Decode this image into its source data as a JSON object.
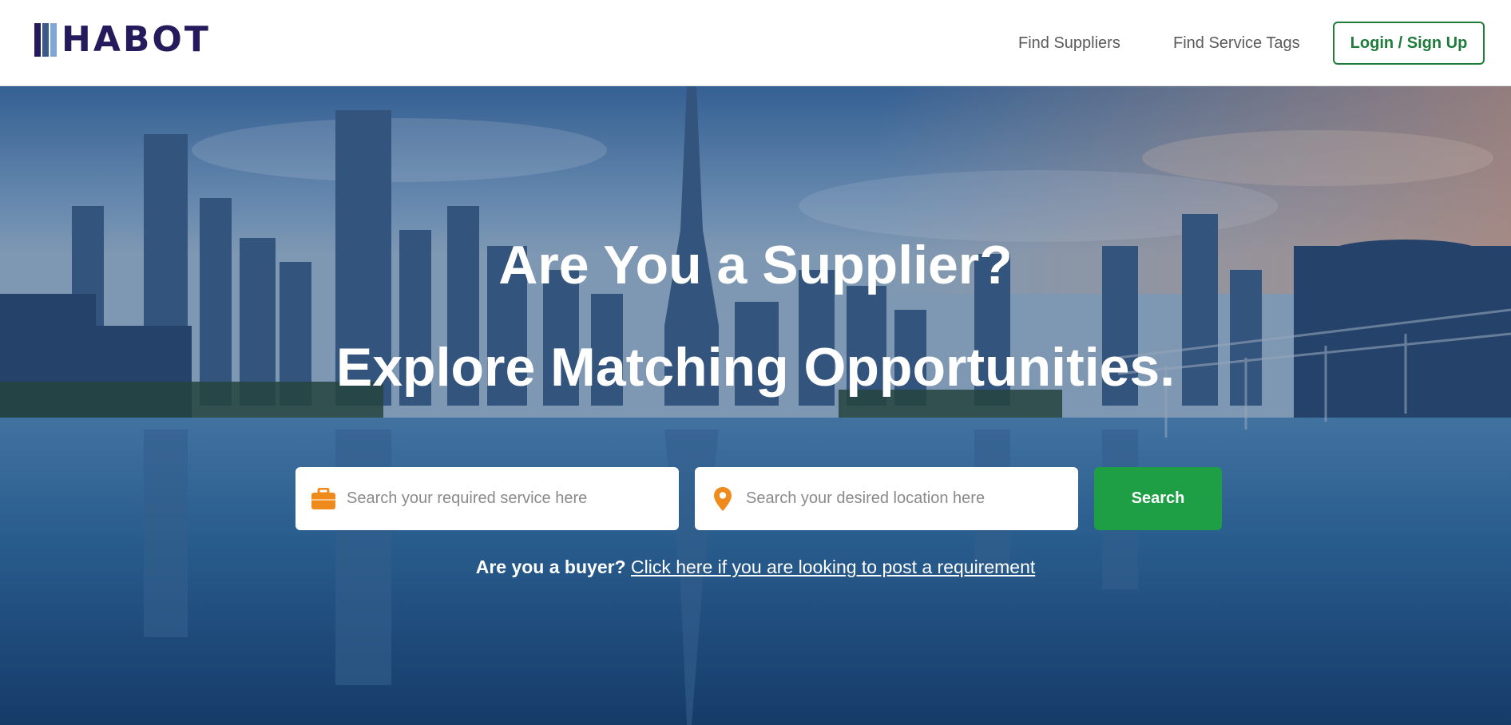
{
  "brand": {
    "name": "HABOT",
    "colors": {
      "text": "#241a5c",
      "bar1": "#241a5c",
      "bar2": "#3b5a8a",
      "bar3": "#7fa6d8"
    }
  },
  "nav": {
    "links": [
      "Find Suppliers",
      "Find Service Tags"
    ],
    "login_label": "Login / Sign Up"
  },
  "hero": {
    "title": "Are You a Supplier?",
    "subtitle": "Explore Matching Opportunities.",
    "service_search": {
      "placeholder": "Search your required service here",
      "icon": "briefcase-icon"
    },
    "location_search": {
      "placeholder": "Search your desired location here",
      "icon": "location-pin-icon"
    },
    "search_label": "Search",
    "buyer_prompt": "Are you a buyer?",
    "buyer_link": "Click here if you are looking to post a requirement"
  },
  "theme": {
    "accent_green": "#1e9e45",
    "login_green": "#1e7b3a",
    "icon_orange": "#ef8a1d"
  }
}
